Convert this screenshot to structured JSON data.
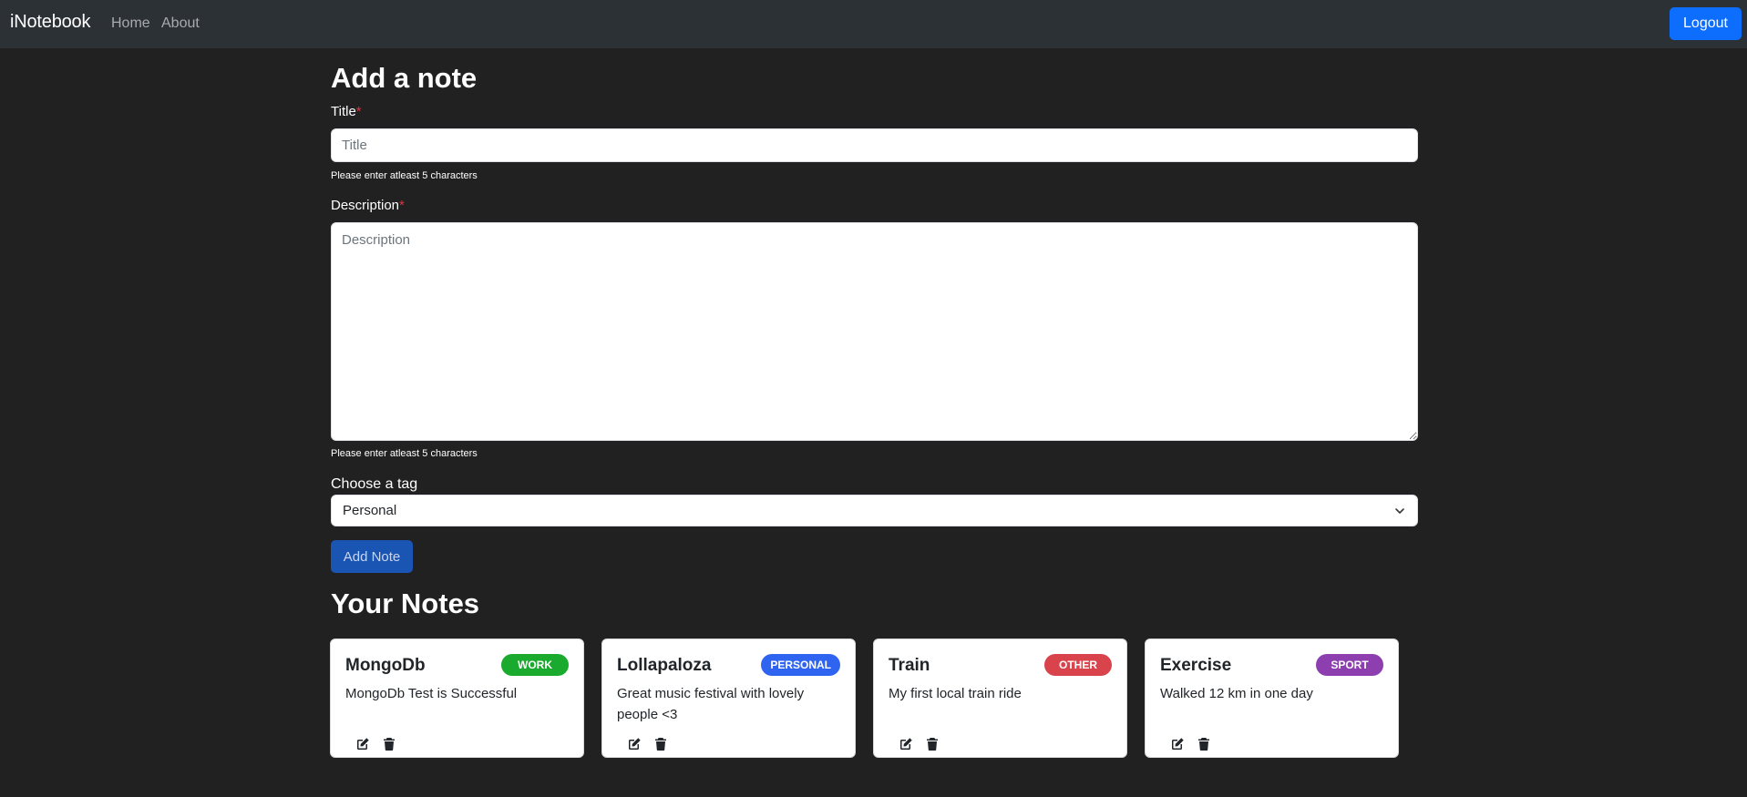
{
  "navbar": {
    "brand": "iNotebook",
    "links": [
      {
        "label": "Home"
      },
      {
        "label": "About"
      }
    ],
    "logout_label": "Logout"
  },
  "form": {
    "heading": "Add a note",
    "title_label": "Title",
    "required_mark": "*",
    "title_placeholder": "Title",
    "title_hint": "Please enter atleast 5 characters",
    "description_label": "Description",
    "description_placeholder": "Description",
    "description_hint": "Please enter atleast 5 characters",
    "tag_label": "Choose a tag",
    "tag_selected": "Personal",
    "submit_label": "Add Note"
  },
  "notes_heading": "Your Notes",
  "notes": [
    {
      "title": "MongoDb",
      "tag": "WORK",
      "tag_color": "#1aaa2e",
      "description": "MongoDb Test is Successful"
    },
    {
      "title": "Lollapaloza",
      "tag": "PERSONAL",
      "tag_color": "#2f64f1",
      "description": "Great music festival with lovely people <3"
    },
    {
      "title": "Train",
      "tag": "OTHER",
      "tag_color": "#d9434b",
      "description": "My first local train ride"
    },
    {
      "title": "Exercise",
      "tag": "SPORT",
      "tag_color": "#8d3fb0",
      "description": "Walked 12 km in one day"
    }
  ],
  "icons": {
    "edit": "edit-icon",
    "delete": "trash-icon",
    "dropdown": "chevron-down-icon"
  }
}
